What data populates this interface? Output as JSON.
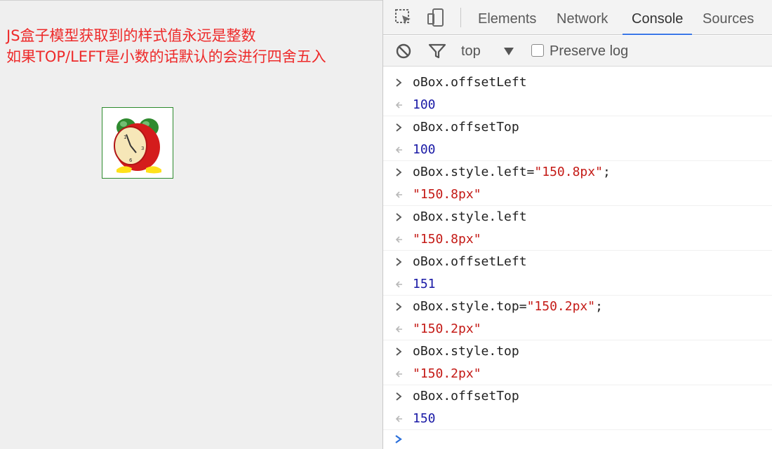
{
  "page": {
    "note_line1": "JS盒子模型获取到的样式值永远是整数",
    "note_line2": "如果TOP/LEFT是小数的话默认的会进行四舍五入",
    "box_icon": "alarm-clock-icon"
  },
  "devtools": {
    "tabs": [
      {
        "label": "Elements"
      },
      {
        "label": "Network"
      },
      {
        "label": "Console"
      },
      {
        "label": "Sources"
      }
    ],
    "active_tab": "Console",
    "context": "top",
    "preserve_log_label": "Preserve log",
    "preserve_log_checked": false
  },
  "console": {
    "entries": [
      {
        "input": "oBox.offsetLeft",
        "pre": "",
        "str": "",
        "post": "",
        "result": "100",
        "result_type": "number"
      },
      {
        "input": "oBox.offsetTop",
        "pre": "",
        "str": "",
        "post": "",
        "result": "100",
        "result_type": "number"
      },
      {
        "input": "",
        "pre": "oBox.style.left=",
        "str": "\"150.8px\"",
        "post": ";",
        "result": "\"150.8px\"",
        "result_type": "string"
      },
      {
        "input": "oBox.style.left",
        "pre": "",
        "str": "",
        "post": "",
        "result": "\"150.8px\"",
        "result_type": "string"
      },
      {
        "input": "oBox.offsetLeft",
        "pre": "",
        "str": "",
        "post": "",
        "result": "151",
        "result_type": "number"
      },
      {
        "input": "",
        "pre": "oBox.style.top=",
        "str": "\"150.2px\"",
        "post": ";",
        "result": "\"150.2px\"",
        "result_type": "string"
      },
      {
        "input": "oBox.style.top",
        "pre": "",
        "str": "",
        "post": "",
        "result": "\"150.2px\"",
        "result_type": "string"
      },
      {
        "input": "oBox.offsetTop",
        "pre": "",
        "str": "",
        "post": "",
        "result": "150",
        "result_type": "number"
      }
    ]
  },
  "colors": {
    "note_red": "#ee2a2a",
    "number_blue": "#1a1aa6",
    "string_red": "#c41a16",
    "tab_underline": "#3b78e7",
    "box_border": "#2c8a2c",
    "prompt_blue": "#2a6fdb"
  }
}
